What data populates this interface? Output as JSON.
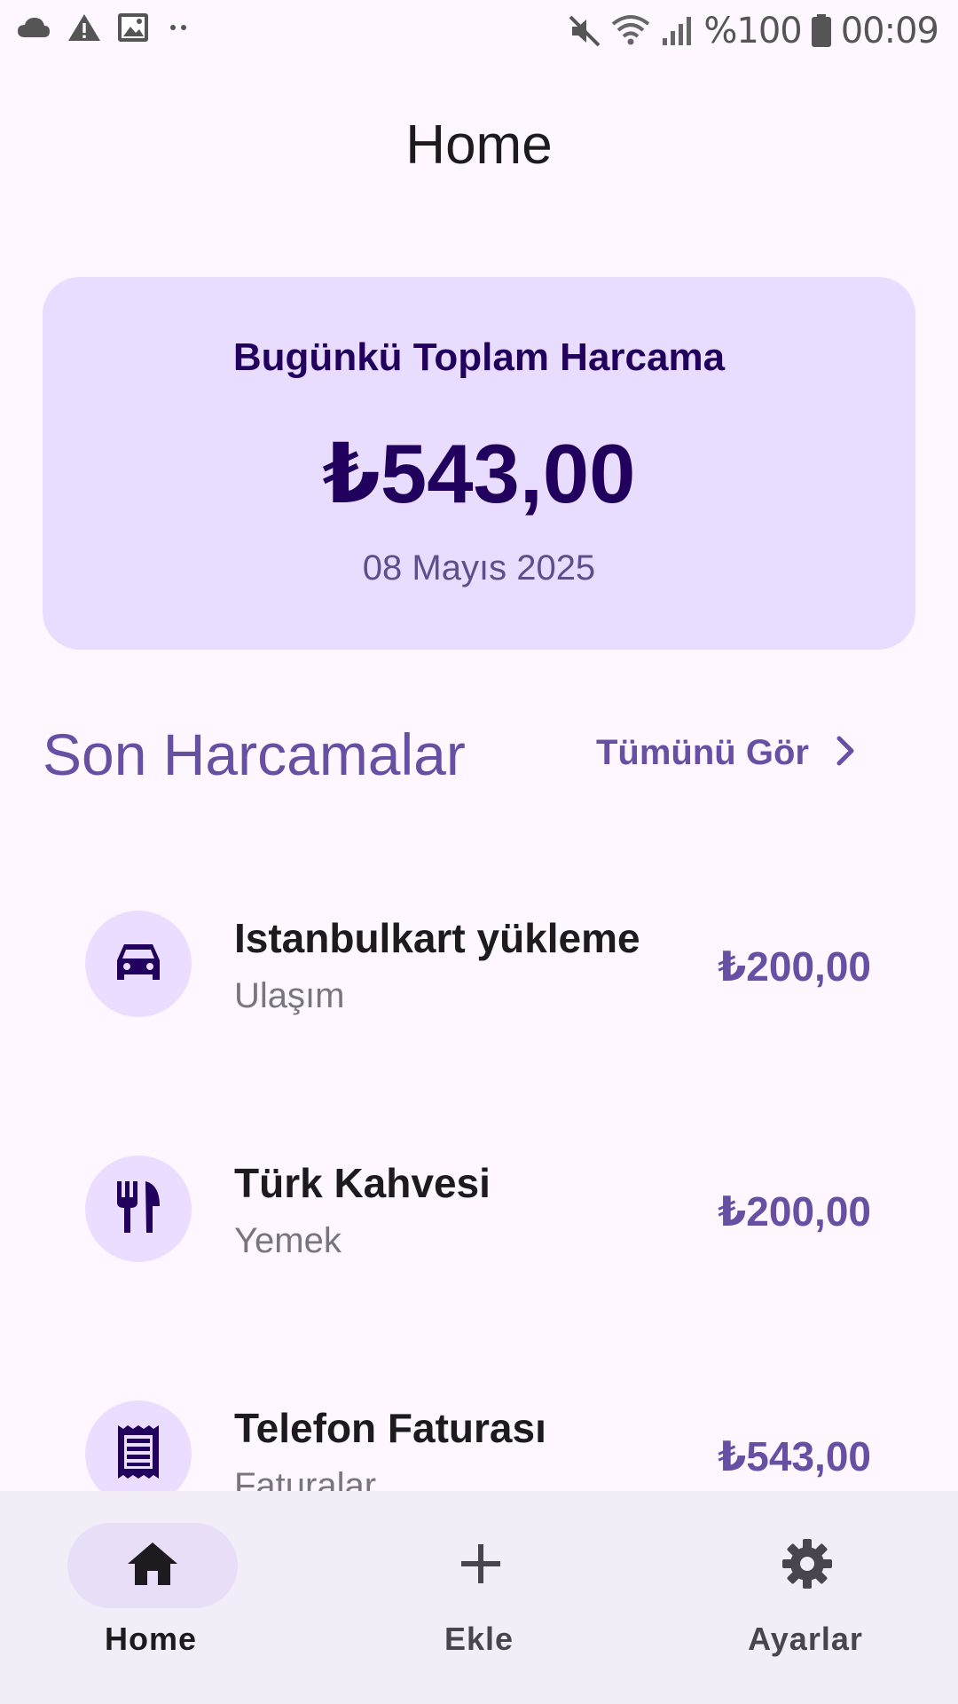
{
  "status_bar": {
    "battery_text": "%100",
    "time": "00:09",
    "left_icons": [
      "cloud-icon",
      "warning-icon",
      "image-icon",
      "more-dots-icon"
    ],
    "right_icons": [
      "mute-icon",
      "wifi-icon",
      "signal-icon",
      "battery-icon"
    ]
  },
  "header": {
    "title": "Home"
  },
  "summary": {
    "label": "Bugünkü Toplam Harcama",
    "amount": "₺543,00",
    "date": "08 Mayıs 2025"
  },
  "recent": {
    "title": "Son Harcamalar",
    "see_all_label": "Tümünü Gör",
    "items": [
      {
        "title": "Istanbulkart yükleme",
        "category": "Ulaşım",
        "amount": "₺200,00",
        "icon": "car-icon"
      },
      {
        "title": "Türk Kahvesi",
        "category": "Yemek",
        "amount": "₺200,00",
        "icon": "restaurant-icon"
      },
      {
        "title": "Telefon Faturası",
        "category": "Faturalar",
        "amount": "₺543,00",
        "icon": "receipt-icon"
      }
    ]
  },
  "bottom_nav": {
    "items": [
      {
        "label": "Home",
        "icon": "home-icon",
        "active": true
      },
      {
        "label": "Ekle",
        "icon": "add-icon",
        "active": false
      },
      {
        "label": "Ayarlar",
        "icon": "settings-icon",
        "active": false
      }
    ]
  },
  "colors": {
    "background": "#FEF7FF",
    "card": "#E9DDFF",
    "primary": "#6750A4",
    "on_card": "#22005D",
    "nav_bg": "#F3EDF7"
  }
}
